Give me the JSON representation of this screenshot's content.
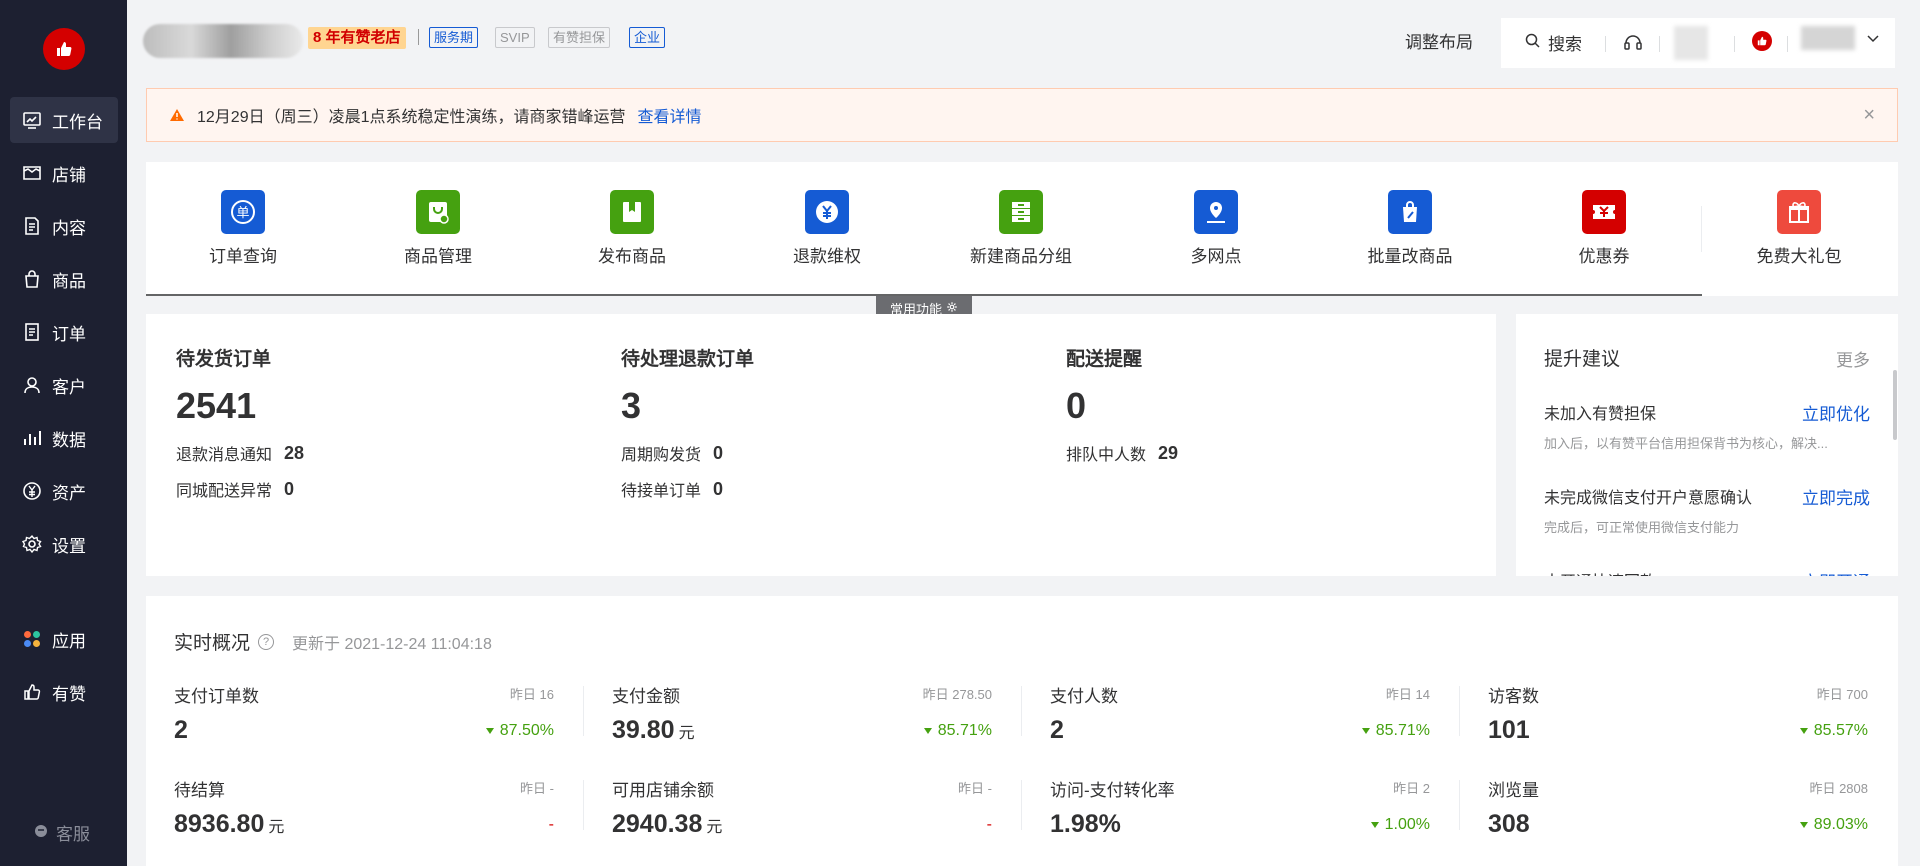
{
  "sidebar": {
    "items": [
      {
        "label": "工作台",
        "icon": "workbench-icon"
      },
      {
        "label": "店铺",
        "icon": "shop-icon"
      },
      {
        "label": "内容",
        "icon": "content-icon"
      },
      {
        "label": "商品",
        "icon": "goods-icon"
      },
      {
        "label": "订单",
        "icon": "order-icon"
      },
      {
        "label": "客户",
        "icon": "customer-icon"
      },
      {
        "label": "数据",
        "icon": "data-icon"
      },
      {
        "label": "资产",
        "icon": "asset-icon"
      },
      {
        "label": "设置",
        "icon": "settings-icon"
      }
    ],
    "apps_label": "应用",
    "youzan_label": "有赞",
    "kefu_label": "客服"
  },
  "header": {
    "old_shop_badge": "8 年有赞老店",
    "tags": [
      "服务期",
      "SVIP",
      "有赞担保",
      "企业"
    ],
    "layout_label": "调整布局",
    "search_label": "搜索"
  },
  "notice": {
    "text": "12月29日（周三）凌晨1点系统稳定性演练，请商家错峰运营",
    "link": "查看详情",
    "close": "×"
  },
  "shortcuts": {
    "items": [
      {
        "label": "订单查询",
        "color": "#155bd4"
      },
      {
        "label": "商品管理",
        "color": "#45a110"
      },
      {
        "label": "发布商品",
        "color": "#45a110"
      },
      {
        "label": "退款维权",
        "color": "#155bd4"
      },
      {
        "label": "新建商品分组",
        "color": "#45a110"
      },
      {
        "label": "多网点",
        "color": "#155bd4"
      },
      {
        "label": "批量改商品",
        "color": "#155bd4"
      },
      {
        "label": "优惠券",
        "color": "#d40000"
      },
      {
        "label": "免费大礼包",
        "color": "#ee4a3d"
      }
    ],
    "common_label": "常用功能"
  },
  "orders": {
    "cols": [
      {
        "title": "待发货订单",
        "value": "2541",
        "rows": [
          {
            "label": "退款消息通知",
            "value": "28"
          },
          {
            "label": "同城配送异常",
            "value": "0"
          }
        ]
      },
      {
        "title": "待处理退款订单",
        "value": "3",
        "rows": [
          {
            "label": "周期购发货",
            "value": "0"
          },
          {
            "label": "待接单订单",
            "value": "0"
          }
        ]
      },
      {
        "title": "配送提醒",
        "value": "0",
        "rows": [
          {
            "label": "排队中人数",
            "value": "29"
          }
        ]
      }
    ]
  },
  "suggest": {
    "title": "提升建议",
    "more": "更多",
    "items": [
      {
        "title": "未加入有赞担保",
        "action": "立即优化",
        "desc": "加入后，以有赞平台信用担保背书为核心，解决..."
      },
      {
        "title": "未完成微信支付开户意愿确认",
        "action": "立即完成",
        "desc": "完成后，可正常使用微信支付能力"
      },
      {
        "title": "未开通快速回款",
        "action": "立即开通",
        "desc": ""
      }
    ]
  },
  "realtime": {
    "title": "实时概况",
    "help": "?",
    "updated": "更新于 2021-12-24 11:04:18",
    "metrics": [
      {
        "name": "支付订单数",
        "yesterday": "昨日 16",
        "value": "2",
        "unit": "",
        "change": "87.50%",
        "dir": "down"
      },
      {
        "name": "支付金额",
        "yesterday": "昨日 278.50",
        "value": "39.80",
        "unit": "元",
        "change": "85.71%",
        "dir": "down"
      },
      {
        "name": "支付人数",
        "yesterday": "昨日 14",
        "value": "2",
        "unit": "",
        "change": "85.71%",
        "dir": "down"
      },
      {
        "name": "访客数",
        "yesterday": "昨日 700",
        "value": "101",
        "unit": "",
        "change": "85.57%",
        "dir": "down"
      },
      {
        "name": "待结算",
        "yesterday": "昨日 -",
        "value": "8936.80",
        "unit": "元",
        "change": "-",
        "dir": "none"
      },
      {
        "name": "可用店铺余额",
        "yesterday": "昨日 -",
        "value": "2940.38",
        "unit": "元",
        "change": "-",
        "dir": "none"
      },
      {
        "name": "访问-支付转化率",
        "yesterday": "昨日 2",
        "value": "1.98%",
        "unit": "",
        "change": "1.00%",
        "dir": "down"
      },
      {
        "name": "浏览量",
        "yesterday": "昨日 2808",
        "value": "308",
        "unit": "",
        "change": "89.03%",
        "dir": "down"
      }
    ]
  }
}
